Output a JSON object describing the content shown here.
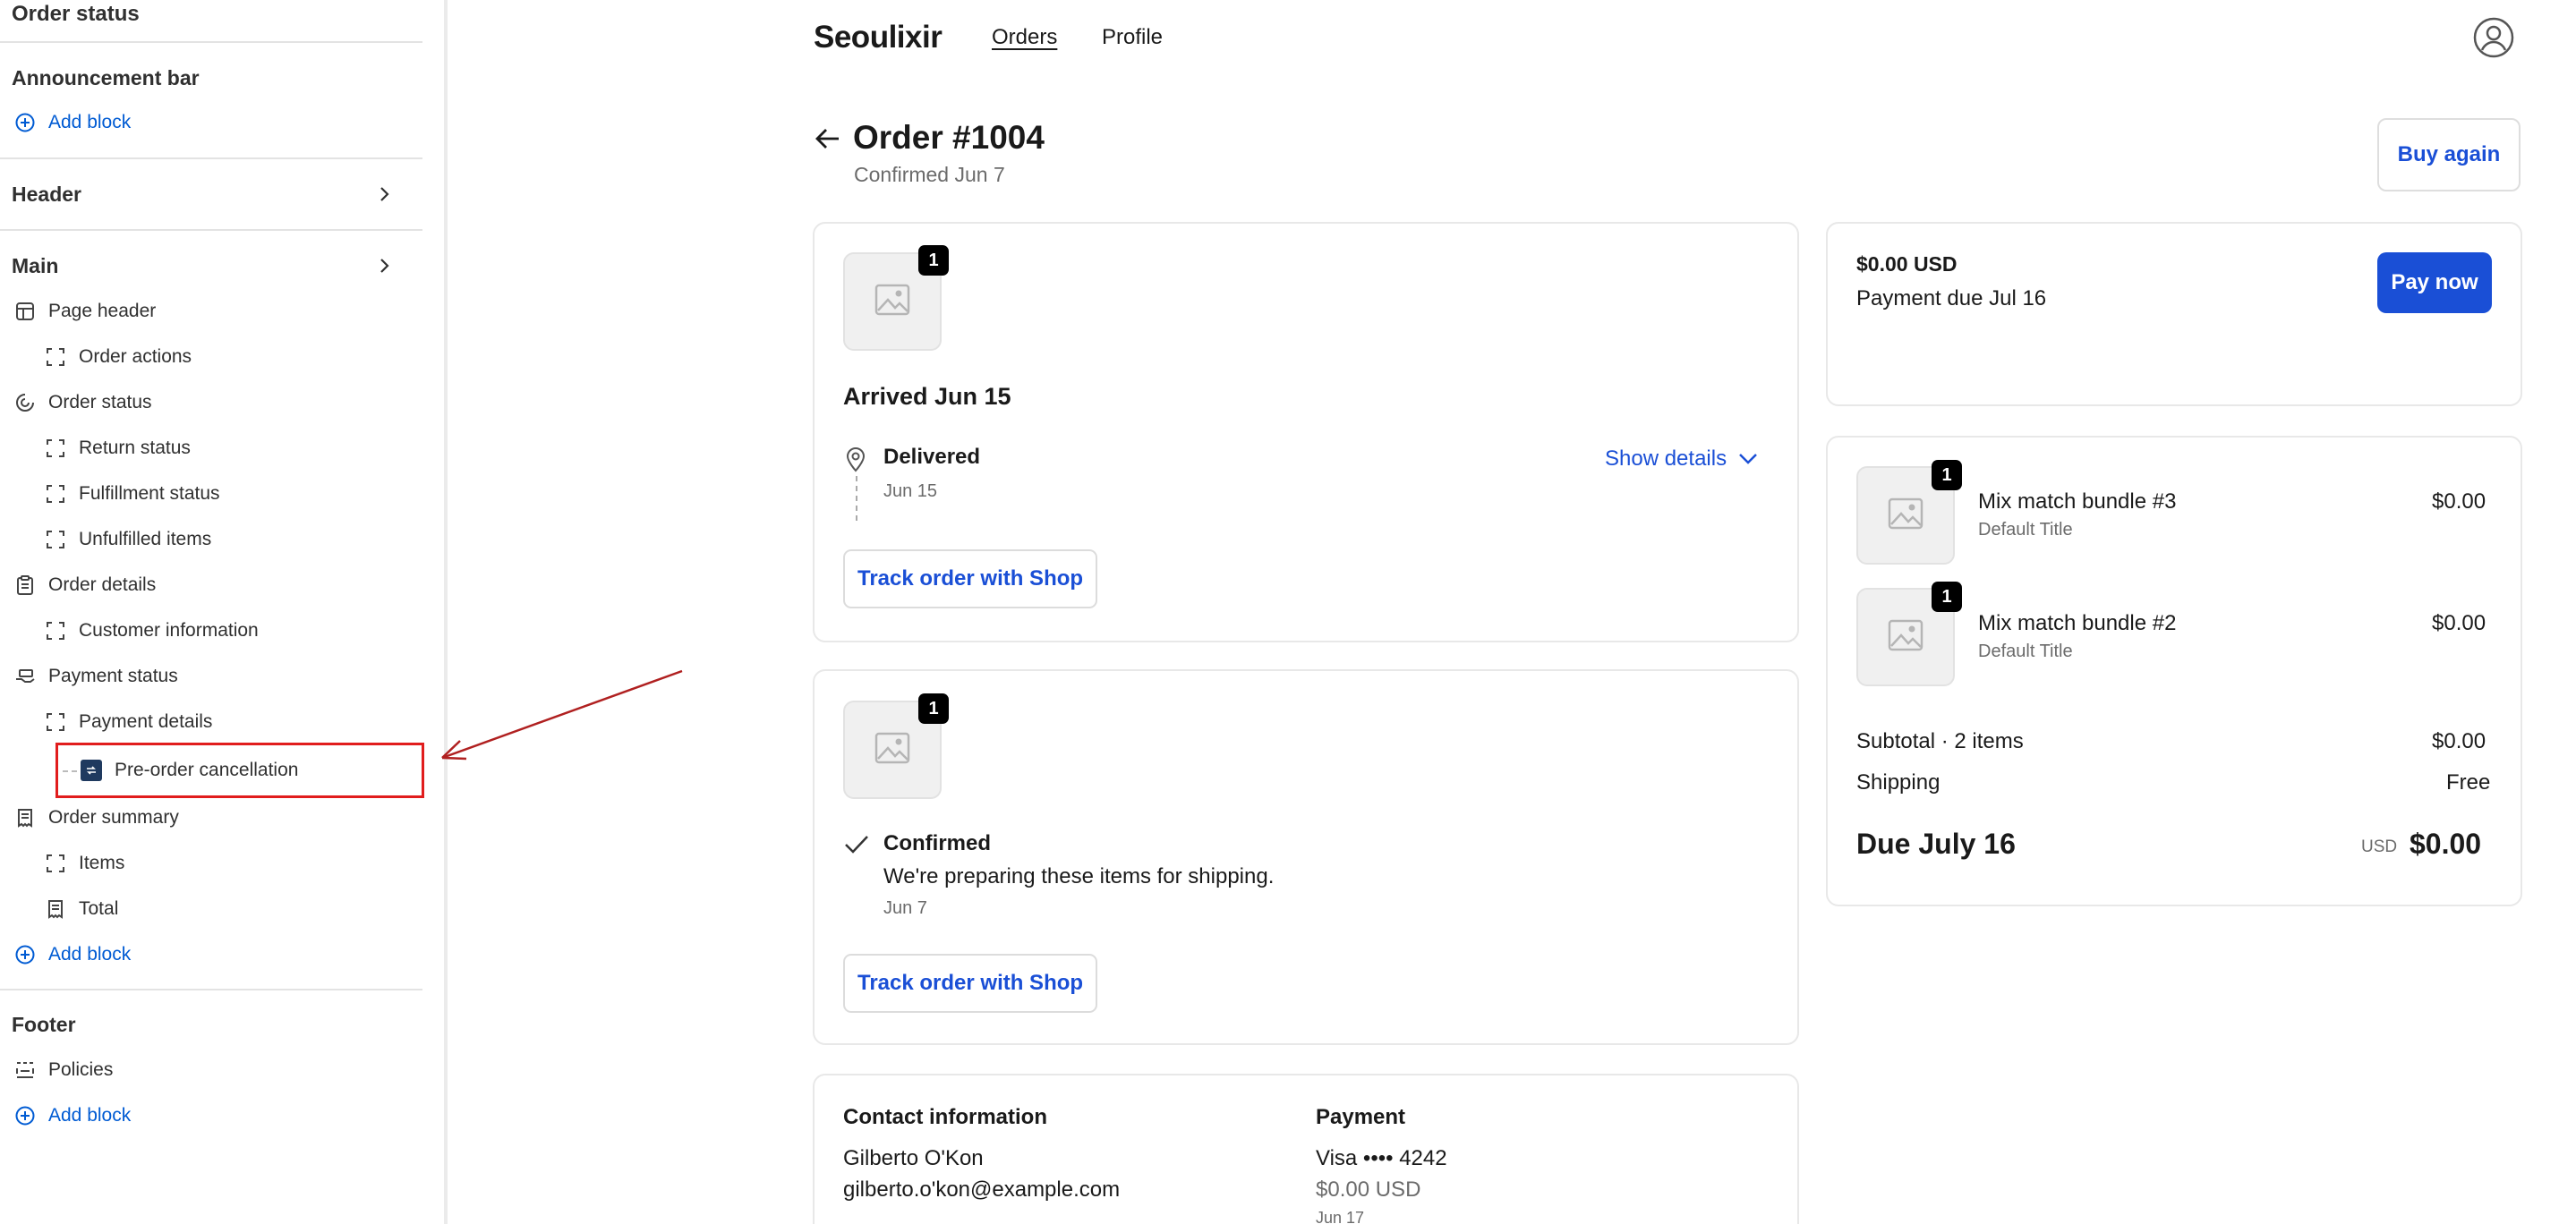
{
  "sidebar": {
    "title": "Order status",
    "announcement": {
      "label": "Announcement bar",
      "add_block": "Add block"
    },
    "header": {
      "label": "Header"
    },
    "main": {
      "label": "Main",
      "items": [
        {
          "label": "Page header",
          "icon": "layout-icon"
        },
        {
          "label": "Order actions",
          "icon": "block-icon"
        },
        {
          "label": "Order status",
          "icon": "status-icon"
        },
        {
          "label": "Return status",
          "icon": "block-icon"
        },
        {
          "label": "Fulfillment status",
          "icon": "block-icon"
        },
        {
          "label": "Unfulfilled items",
          "icon": "block-icon"
        },
        {
          "label": "Order details",
          "icon": "clipboard-icon"
        },
        {
          "label": "Customer information",
          "icon": "block-icon"
        },
        {
          "label": "Payment status",
          "icon": "hand-money-icon"
        },
        {
          "label": "Payment details",
          "icon": "block-icon"
        },
        {
          "label": "Pre-order cancellation",
          "icon": "app-icon"
        },
        {
          "label": "Order summary",
          "icon": "receipt-icon"
        },
        {
          "label": "Items",
          "icon": "block-icon"
        },
        {
          "label": "Total",
          "icon": "receipt-icon"
        }
      ],
      "add_block": "Add block"
    },
    "footer": {
      "label": "Footer",
      "items": [
        {
          "label": "Policies",
          "icon": "policies-icon"
        }
      ],
      "add_block": "Add block"
    }
  },
  "store": {
    "brand": "Seoulixir",
    "nav": {
      "orders": "Orders",
      "profile": "Profile"
    }
  },
  "order": {
    "title": "Order #1004",
    "subtitle": "Confirmed Jun 7",
    "buy_again": "Buy again"
  },
  "shipment1": {
    "qty": "1",
    "title": "Arrived Jun 15",
    "status": "Delivered",
    "status_date": "Jun 15",
    "show_details": "Show details",
    "track": "Track order with Shop"
  },
  "shipment2": {
    "qty": "1",
    "status": "Confirmed",
    "message": "We're preparing these items for shipping.",
    "status_date": "Jun 7",
    "track": "Track order with Shop"
  },
  "info": {
    "contact_heading": "Contact information",
    "contact_name": "Gilberto O'Kon",
    "contact_email": "gilberto.o'kon@example.com",
    "payment_heading": "Payment",
    "payment_card": "Visa •••• 4242",
    "payment_amount": "$0.00 USD",
    "payment_date": "Jun 17"
  },
  "payment_due": {
    "amount": "$0.00 USD",
    "due": "Payment due Jul 16",
    "pay_now": "Pay now"
  },
  "summary": {
    "items": [
      {
        "qty": "1",
        "name": "Mix match bundle #3",
        "variant": "Default Title",
        "price": "$0.00"
      },
      {
        "qty": "1",
        "name": "Mix match bundle #2",
        "variant": "Default Title",
        "price": "$0.00"
      }
    ],
    "subtotal_label": "Subtotal · 2 items",
    "subtotal": "$0.00",
    "shipping_label": "Shipping",
    "shipping": "Free",
    "due_label": "Due July 16",
    "currency": "USD",
    "total": "$0.00"
  },
  "colors": {
    "accent": "#1a4fd6",
    "highlight": "#e11d1d",
    "arrow": "#b02020"
  }
}
